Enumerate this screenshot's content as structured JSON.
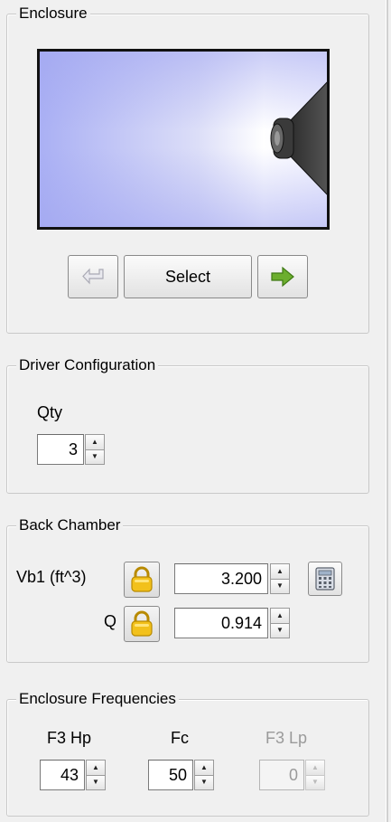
{
  "enclosure": {
    "title": "Enclosure",
    "select_label": "Select",
    "prev_icon": "back-arrow-icon",
    "next_icon": "forward-arrow-icon",
    "preview_icon": "speaker-driver-icon"
  },
  "driver_config": {
    "title": "Driver Configuration",
    "qty_label": "Qty",
    "qty_value": "3"
  },
  "back_chamber": {
    "title": "Back Chamber",
    "vb1_label": "Vb1 (ft^3)",
    "vb1_value": "3.200",
    "q_label": "Q",
    "q_value": "0.914",
    "lock_icon": "padlock-icon",
    "calc_icon": "calculator-icon"
  },
  "frequencies": {
    "title": "Enclosure Frequencies",
    "f3hp_label": "F3 Hp",
    "f3hp_value": "43",
    "fc_label": "Fc",
    "fc_value": "50",
    "f3lp_label": "F3 Lp",
    "f3lp_value": "0"
  },
  "colors": {
    "accent_green": "#6cae2e",
    "lock_yellow": "#f2c11c"
  }
}
